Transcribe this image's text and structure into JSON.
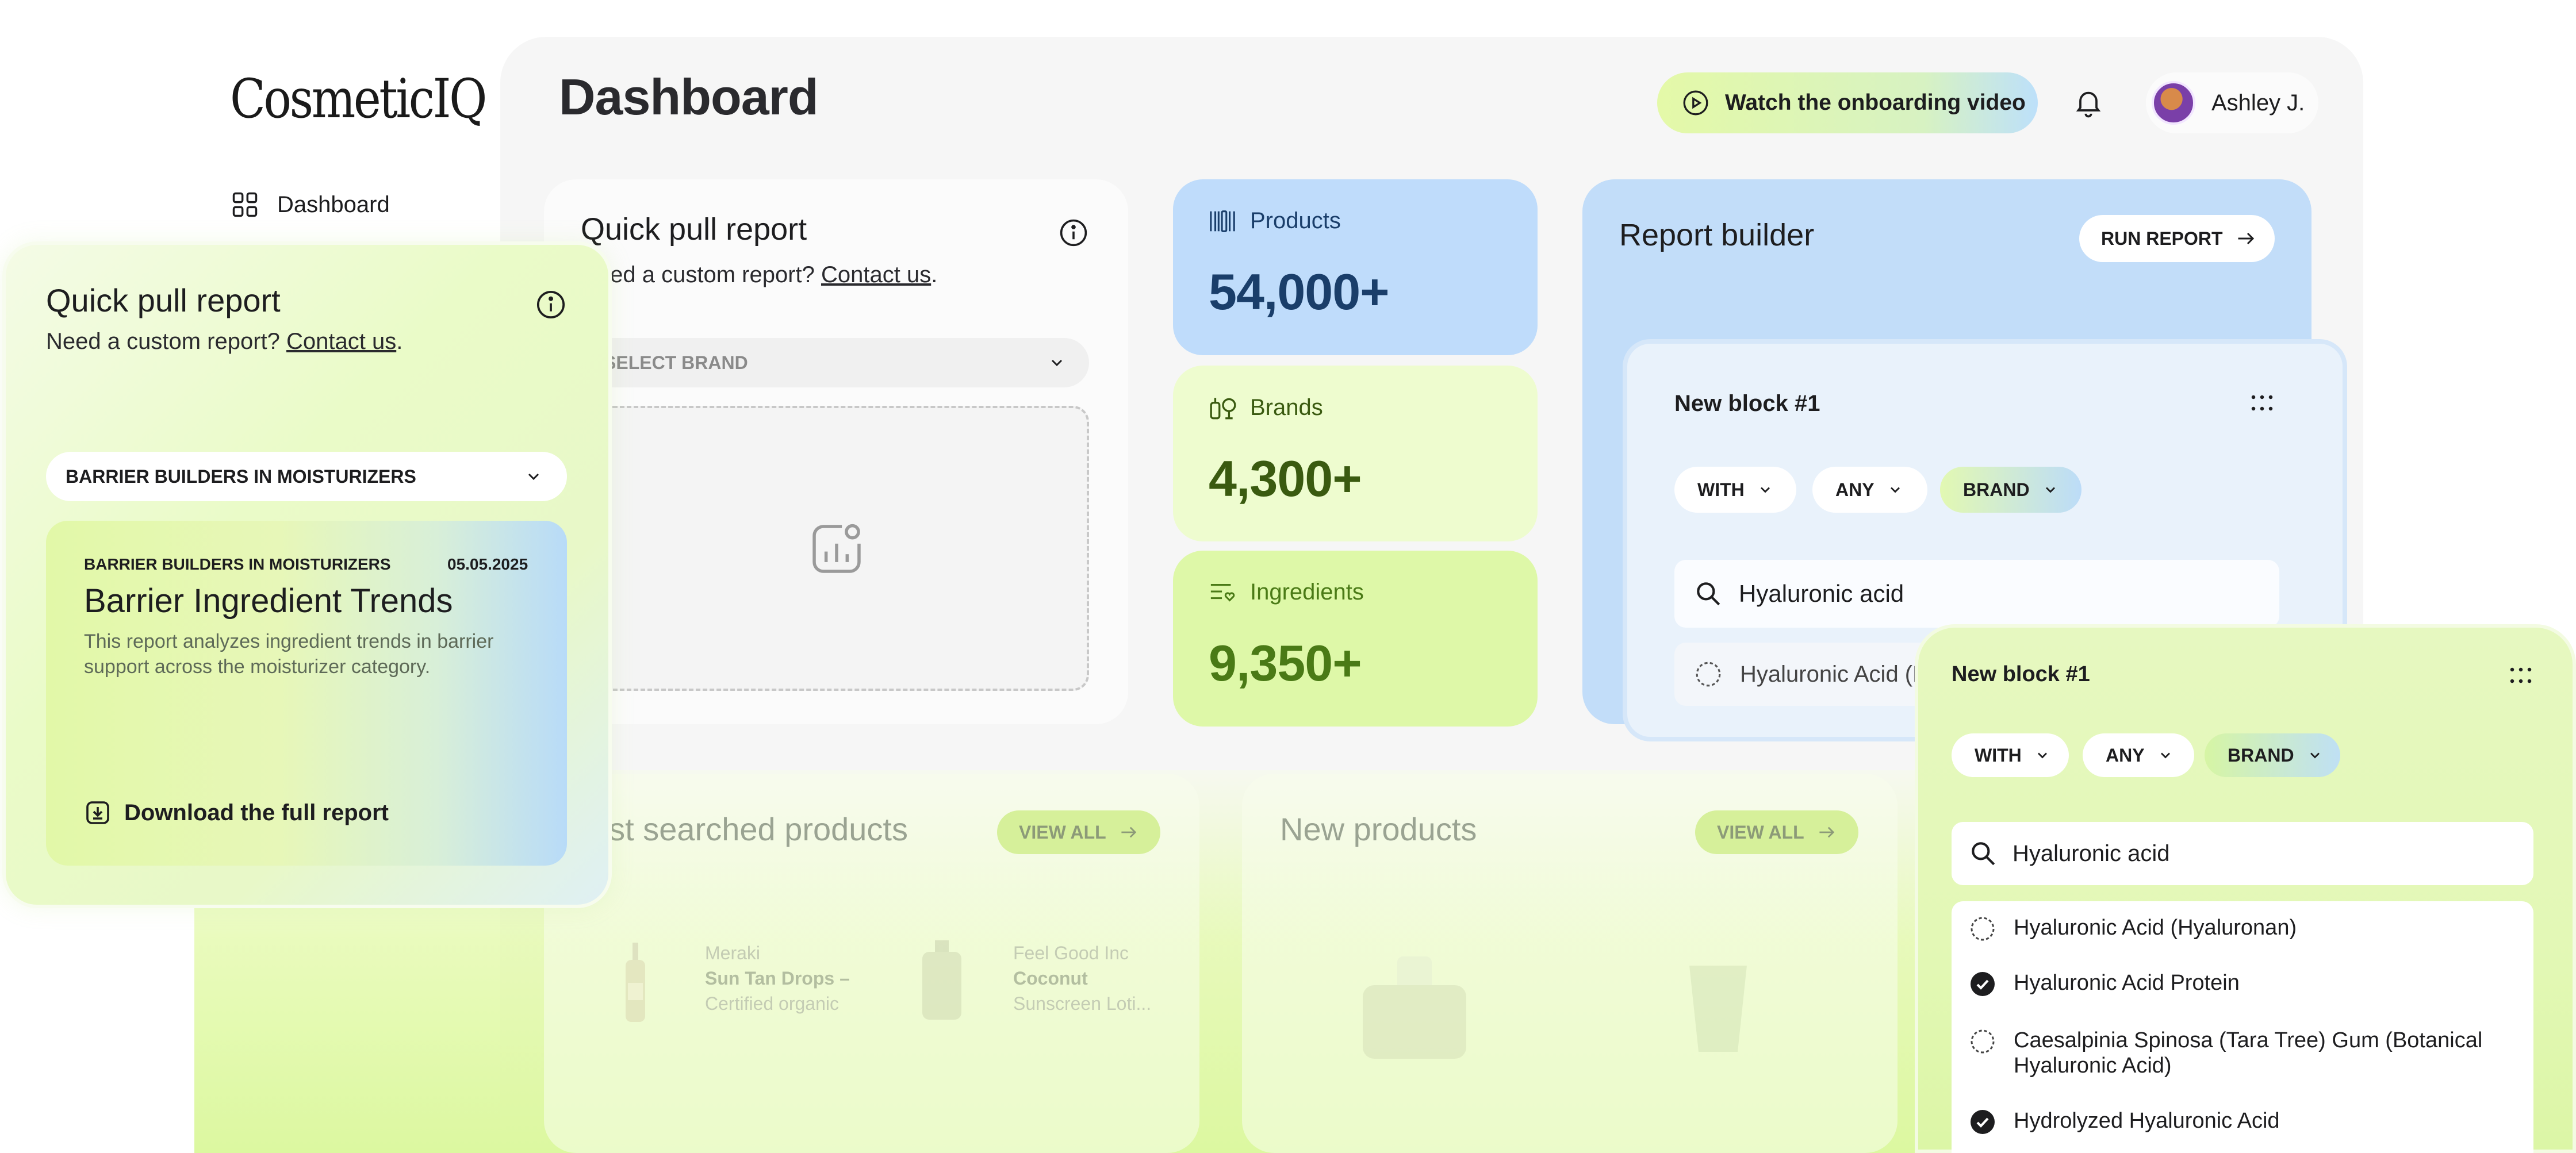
{
  "app": {
    "logo": "CosmeticIQ"
  },
  "sidebar": {
    "items": [
      {
        "label": "Dashboard",
        "icon": "grid-icon"
      }
    ]
  },
  "header": {
    "title": "Dashboard",
    "watch_label": "Watch the onboarding video",
    "user_name": "Ashley J."
  },
  "quick_pull": {
    "title": "Quick pull report",
    "sub_prefix": "Need a custom report?",
    "sub_link": "Contact us",
    "sub_suffix": ".",
    "select_placeholder": "SELECT BRAND",
    "selected_value": "BARRIER BUILDERS IN MOISTURIZERS",
    "report": {
      "category": "BARRIER BUILDERS IN MOISTURIZERS",
      "date": "05.05.2025",
      "title": "Barrier Ingredient Trends",
      "description": "This report analyzes ingredient trends in barrier support across the moisturizer category.",
      "download_label": "Download the full report"
    }
  },
  "stats": [
    {
      "label": "Products",
      "value": "54,000+",
      "icon": "barcode-icon"
    },
    {
      "label": "Brands",
      "value": "4,300+",
      "icon": "bottles-icon"
    },
    {
      "label": "Ingredients",
      "value": "9,350+",
      "icon": "list-heart-icon"
    }
  ],
  "report_builder": {
    "title": "Report builder",
    "run_label": "RUN REPORT",
    "block_title": "New block #1",
    "chips": [
      "WITH",
      "ANY",
      "BRAND"
    ],
    "search_value": "Hyaluronic acid",
    "results": [
      {
        "label": "Hyaluronic Acid (Hyaluronan)",
        "checked": false
      },
      {
        "label": "Hyaluronic Acid Protein",
        "checked": true
      },
      {
        "label": "Caesalpinia Spinosa (Tara Tree) Gum (Botanical Hyaluronic Acid)",
        "checked": false
      },
      {
        "label": "Hydrolyzed Hyaluronic Acid",
        "checked": true
      }
    ],
    "partial_result": "Hyaluronic Acid (H"
  },
  "most_searched": {
    "title": "ost searched products",
    "view_all": "VIEW ALL",
    "products": [
      {
        "brand": "Meraki",
        "name_line1": "Sun Tan Drops –",
        "name_line2": "Certified organic"
      },
      {
        "brand": "Feel Good Inc",
        "name_line1": "Coconut",
        "name_line2": "Sunscreen Loti..."
      }
    ]
  },
  "new_products": {
    "title": "New products",
    "view_all": "VIEW ALL"
  },
  "colors": {
    "accent_green": "#dcf8a0",
    "accent_blue": "#bfdcfb",
    "panel_bg": "#f6f6f6"
  }
}
